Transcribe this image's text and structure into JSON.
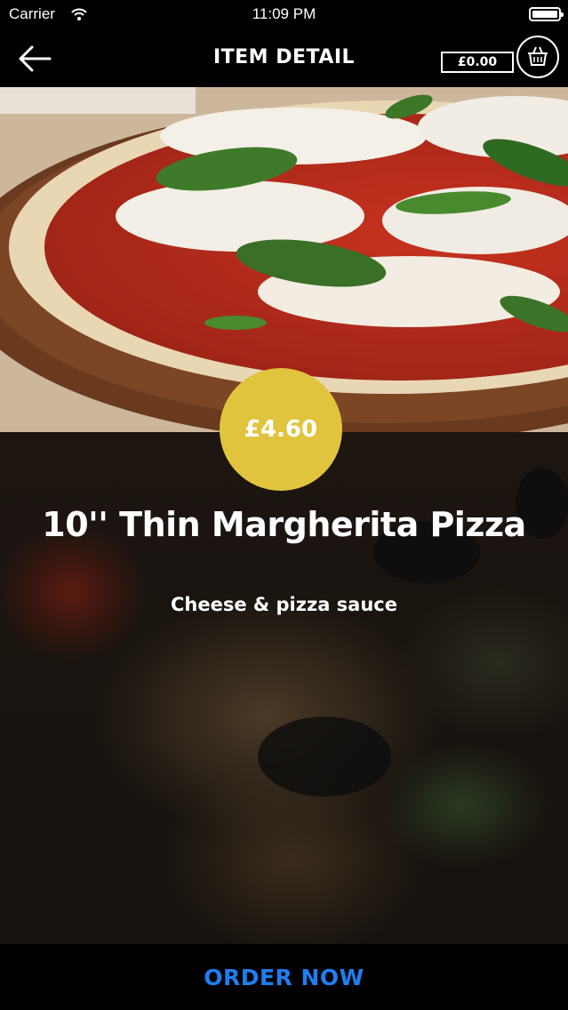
{
  "status_bar": {
    "carrier": "Carrier",
    "time": "11:09 PM"
  },
  "nav": {
    "title": "ITEM DETAIL",
    "cart_total": "£0.00"
  },
  "item": {
    "price": "£4.60",
    "title": "10'' Thin Margherita Pizza",
    "description": "Cheese & pizza sauce"
  },
  "footer": {
    "order_label": "ORDER NOW"
  },
  "colors": {
    "badge": "#e1c43d",
    "order_text": "#1f7ef0",
    "bar": "#000000"
  },
  "icons": {
    "back": "arrow-left-icon",
    "cart": "basket-icon",
    "wifi": "wifi-icon",
    "battery": "battery-icon"
  }
}
